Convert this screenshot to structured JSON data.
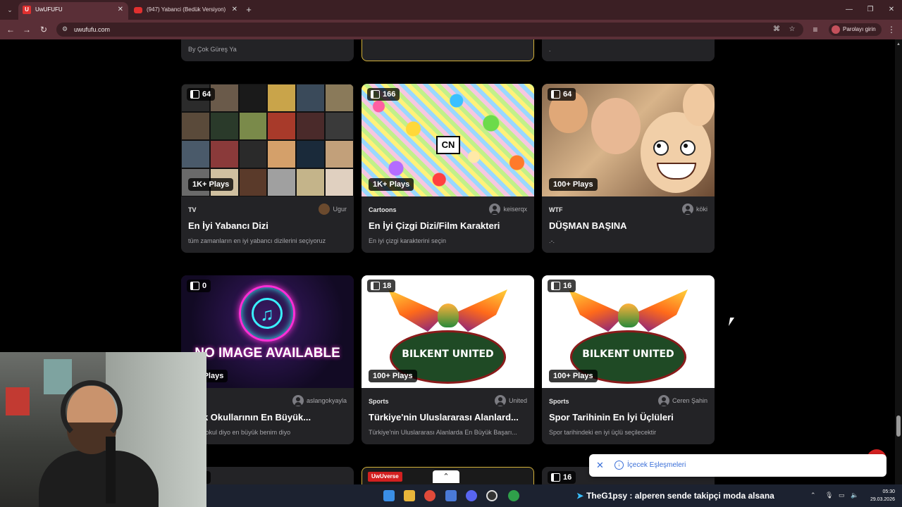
{
  "browser": {
    "tabs": [
      {
        "title": "UwUFUFU",
        "favicon": "U",
        "active": true
      },
      {
        "title": "(947) Yabanci (Bedük Versiyon)",
        "active": false
      }
    ],
    "url": "uwufufu.com",
    "password_button": "Parolayı girin"
  },
  "top_partial": {
    "left_desc": "By Çok Güreş Ya",
    "right_desc": "."
  },
  "cards": [
    {
      "count": "64",
      "plays": "1K+ Plays",
      "category": "TV",
      "author": "Ugur",
      "title": "En İyi Yabancı Dizi",
      "desc": "tüm zamanların en iyi yabancı dizilerini seçiyoruz"
    },
    {
      "count": "166",
      "plays": "1K+ Plays",
      "category": "Cartoons",
      "author": "keiserqx",
      "title": "En İyi Çizgi Dizi/Film Karakteri",
      "desc": "En iyi çizgi karakterini seçin",
      "logo": "CN"
    },
    {
      "count": "64",
      "plays": "100+ Plays",
      "category": "WTF",
      "author": "köki",
      "title": "DÜŞMAN BAŞINA",
      "desc": ".-."
    },
    {
      "count": "0",
      "plays": "0+ Plays",
      "category": "",
      "author": "aslangokyayla",
      "title": "Türk Okullarının En Büyük...",
      "desc": "hangi okul diyo en büyük benim diyo",
      "image_text": "NO IMAGE AVAILABLE"
    },
    {
      "count": "18",
      "plays": "100+ Plays",
      "category": "Sports",
      "author": "United",
      "title": "Türkiye'nin Uluslararası Alanlard...",
      "desc": "Türkiye'nin Uluslararası Alanlarda En Büyük Başarı...",
      "image_text": "BILKENT UNITED"
    },
    {
      "count": "16",
      "plays": "100+ Plays",
      "category": "Sports",
      "author": "Ceren Şahin",
      "title": "Spor Tarihinin En İyi Üçlüleri",
      "desc": "Spor tarihindeki en iyi üçlü seçilecektir",
      "image_text": "BILKENT UNITED"
    }
  ],
  "bottom_partial": {
    "left_count": "9",
    "mid_badge": "UwUverse",
    "right_count": "16"
  },
  "toast": {
    "label": "İçecek Eşleşmeleri",
    "close": "✕"
  },
  "taskbar": {
    "stream_text": "TheG1psy : alperen sende takipçi moda alsana",
    "time": "05:30",
    "date": "29.03.2026"
  },
  "colors": {
    "tab_bar": "#3b1f24",
    "address_bar": "#5a2f37",
    "card_bg": "#232326",
    "gold_border": "#d4b23a"
  }
}
